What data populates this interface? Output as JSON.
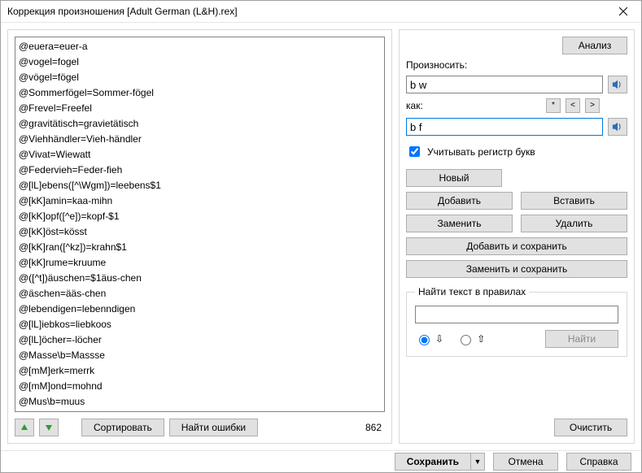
{
  "window": {
    "title": "Коррекция произношения [Adult German (L&H).rex]"
  },
  "left": {
    "items": [
      "@euera=euer-a",
      "@vogel=fogel",
      "@vögel=fögel",
      "@Sommerfögel=Sommer-fögel",
      "@Frevel=Freefel",
      "@gravitätisch=gravietätisch",
      "@Viehhändler=Vieh-händler",
      "@Vivat=Wiewatt",
      "@Federvieh=Feder-fieh",
      "@[lL]ebens([^\\Wgm])=leebens$1",
      "@[kK]amin=kaa-mihn",
      "@[kK]opf([^e])=kopf-$1",
      "@[kK]öst=kösst",
      "@[kK]ran([^kz])=krahn$1",
      "@[kK]rume=kruume",
      "@([^t])äuschen=$1äus-chen",
      "@äschen=ääs-chen",
      "@lebendigen=lebenndigen",
      "@[lL]iebkos=liebkoos",
      "@[lL]öcher=-löcher",
      "@Masse\\b=Massse",
      "@[mM]erk=merrk",
      "@[mM]ond=mohnd",
      "@Mus\\b=muus"
    ],
    "sort": "Сортировать",
    "findErrors": "Найти ошибки",
    "count": "862"
  },
  "right": {
    "analysis": "Анализ",
    "pronounceLabel": "Произносить:",
    "pronounceValue": "b w",
    "asLabel": "как:",
    "asValue": "b f",
    "nav": {
      "star": "*",
      "prev": "<",
      "next": ">"
    },
    "caseSensitive": "Учитывать регистр букв",
    "caseChecked": true,
    "new": "Новый",
    "add": "Добавить",
    "insert": "Вставить",
    "replace": "Заменить",
    "delete": "Удалить",
    "addSave": "Добавить и сохранить",
    "replaceSave": "Заменить и сохранить",
    "findGroup": "Найти текст в правилах",
    "findValue": "",
    "findBtn": "Найти",
    "clear": "Очистить"
  },
  "footer": {
    "save": "Сохранить",
    "cancel": "Отмена",
    "help": "Справка"
  }
}
